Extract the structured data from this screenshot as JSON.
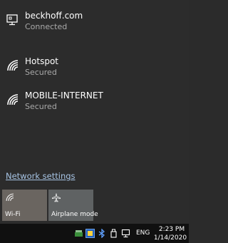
{
  "networks": [
    {
      "name": "beckhoff.com",
      "status": "Connected",
      "icon": "ethernet-monitor-icon"
    },
    {
      "name": "Hotspot",
      "status": "Secured",
      "icon": "wifi-icon"
    },
    {
      "name": "MOBILE-INTERNET",
      "status": "Secured",
      "icon": "wifi-icon"
    }
  ],
  "settings_link": "Network settings",
  "quick_actions": [
    {
      "label": "Wi-Fi",
      "icon": "wifi-icon"
    },
    {
      "label": "Airplane mode",
      "icon": "airplane-icon"
    }
  ],
  "taskbar": {
    "language": "ENG",
    "time": "2:23 PM",
    "date": "1/14/2020"
  },
  "colors": {
    "flyout_bg": "#2c2c2c",
    "link": "#a7c4e4",
    "secondary_text": "#a9a9a9",
    "taskbar_bg": "#101010"
  }
}
